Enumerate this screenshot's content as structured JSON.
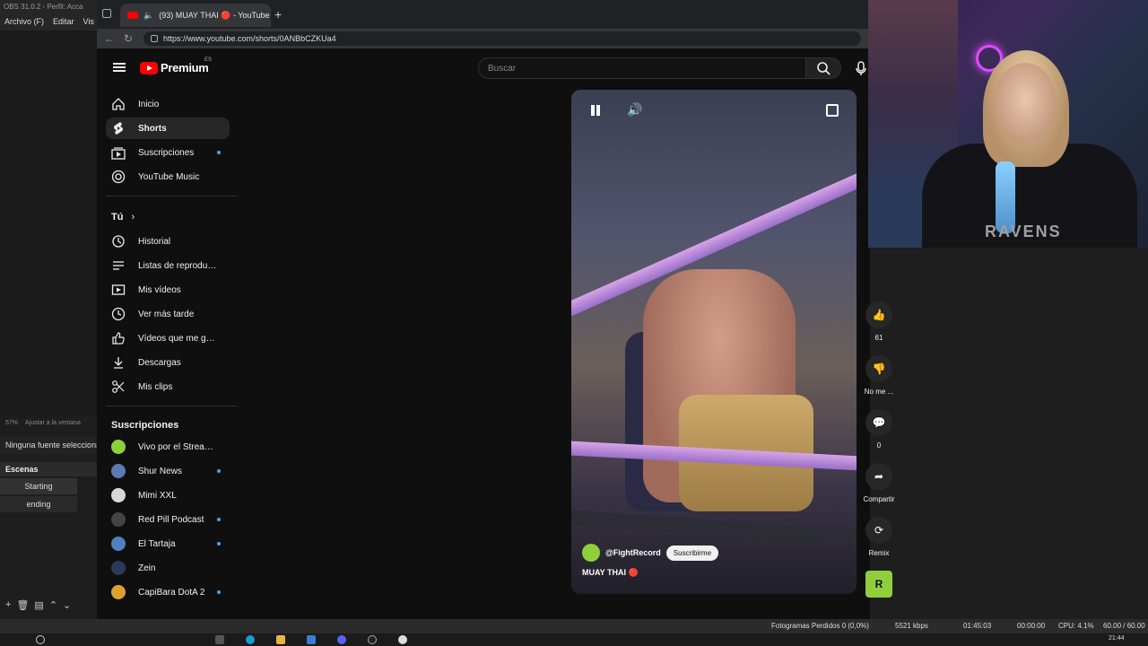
{
  "obs": {
    "title": "OBS 31.0.2 - Perfil: Acca",
    "menu": [
      "Archivo (F)",
      "Editar",
      "Vis"
    ],
    "zoom": "57%",
    "zoom_label": "Ajustar a la ventana",
    "no_source": "Ninguna fuente seleccionada",
    "scenes_header": "Escenas",
    "scenes": [
      "Starting",
      "ending"
    ]
  },
  "browser": {
    "tab_title": "(93) MUAY THAI 🔴 - YouTube",
    "url": "https://www.youtube.com/shorts/0ANBbCZKUa4"
  },
  "youtube": {
    "brand": "Premium",
    "region": "ES",
    "search_placeholder": "Buscar",
    "nav": [
      {
        "label": "Inicio",
        "icon": "home-icon"
      },
      {
        "label": "Shorts",
        "icon": "shorts-icon"
      },
      {
        "label": "Suscripciones",
        "icon": "subscriptions-icon"
      },
      {
        "label": "YouTube Music",
        "icon": "music-icon"
      }
    ],
    "you_heading": "Tú",
    "you_items": [
      {
        "label": "Historial",
        "icon": "history-icon"
      },
      {
        "label": "Listas de reproducc...",
        "icon": "playlist-icon"
      },
      {
        "label": "Mis vídeos",
        "icon": "video-icon"
      },
      {
        "label": "Ver más tarde",
        "icon": "clock-icon"
      },
      {
        "label": "Vídeos que me gus...",
        "icon": "thumb-up-icon"
      },
      {
        "label": "Descargas",
        "icon": "download-icon"
      },
      {
        "label": "Mis clips",
        "icon": "scissors-icon"
      }
    ],
    "subs_heading": "Suscripciones",
    "subs": [
      {
        "label": "Vivo por el Streami...",
        "color": "#8fcf3c"
      },
      {
        "label": "Shur News",
        "color": "#5c7ab0"
      },
      {
        "label": "Mimi XXL",
        "color": "#d8d8d8"
      },
      {
        "label": "Red Pill Podcast",
        "color": "#444444"
      },
      {
        "label": "El Tartaja",
        "color": "#5080c0"
      },
      {
        "label": "Zein",
        "color": "#2a3a5a"
      },
      {
        "label": "CapiBara DotA 2",
        "color": "#e0a030"
      }
    ],
    "short": {
      "channel": "@FightRecord",
      "subscribe": "Suscribirme",
      "title": "MUAY THAI 🔴"
    },
    "actions": {
      "likes": "61",
      "dislike": "No me ...",
      "comments": "0",
      "share": "Compartir",
      "remix": "Remix"
    }
  },
  "webcam": {
    "shirt_text": "RAVENS"
  },
  "status": {
    "dropped": "Fotogramas Perdidos 0 (0,0%)",
    "bitrate": "5521 kbps",
    "stream_time": "01:45:03",
    "rec_time": "00:00:00",
    "cpu": "CPU: 4.1%",
    "fps": "60.00 / 60.00",
    "clock": "21:44"
  }
}
